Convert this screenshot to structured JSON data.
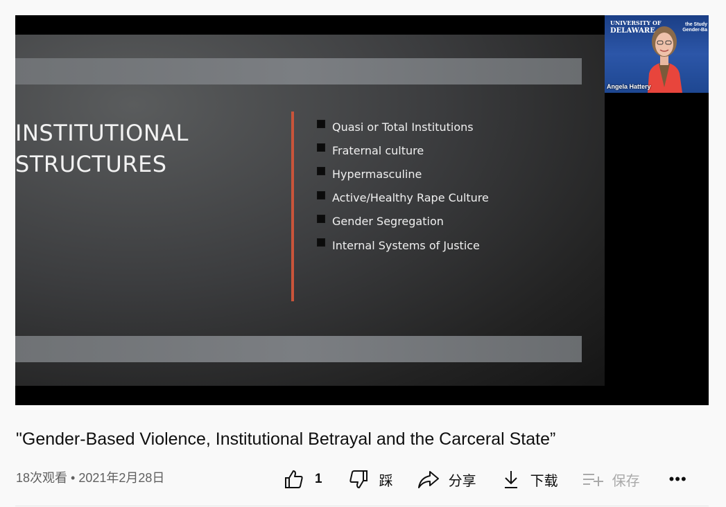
{
  "slide": {
    "title_lines": [
      "INSTITUTIONAL",
      "STRUCTURES"
    ],
    "bullets": [
      "Quasi or Total Institutions",
      "Fraternal culture",
      "Hypermasculine",
      "Active/Healthy Rape Culture",
      "Gender Segregation",
      "Internal Systems of Justice"
    ],
    "accent_color": "#c9543a"
  },
  "webcam": {
    "logo_line1": "UNIVERSITY OF",
    "logo_line2": "DELAWARE.",
    "side_text_line1": "the Study",
    "side_text_line2": "Gender-Ba",
    "speaker_name": "Angela Hattery"
  },
  "video": {
    "title": "\"Gender-Based Violence, Institutional Betrayal and the Carceral State”",
    "meta": "18次观看 • 2021年2月28日"
  },
  "actions": {
    "like_count": "1",
    "dislike_label": "踩",
    "share_label": "分享",
    "download_label": "下载",
    "save_label": "保存",
    "more_label": "•••"
  },
  "icons": [
    "thumbs-up-icon",
    "thumbs-down-icon",
    "share-arrow-icon",
    "download-icon",
    "playlist-add-icon",
    "more-icon"
  ]
}
